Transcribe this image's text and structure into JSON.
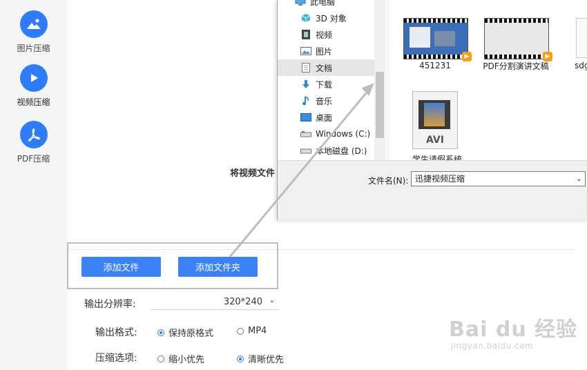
{
  "sidebar": {
    "items": [
      {
        "label": "图片压缩",
        "icon": "image-icon"
      },
      {
        "label": "视频压缩",
        "icon": "play-icon"
      },
      {
        "label": "PDF压缩",
        "icon": "pdf-icon"
      }
    ],
    "accent": "#2f7cf6"
  },
  "main": {
    "drop_text": "将视频文件",
    "add_file_button": "添加文件",
    "add_folder_button": "添加文件夹",
    "resolution_label": "输出分辨率:",
    "resolution_value": "320*240",
    "format_label": "输出格式:",
    "format_options": [
      "保持原格式",
      "MP4"
    ],
    "format_selected": "保持原格式",
    "compress_label": "压缩选项:",
    "compress_options": [
      "缩小优先",
      "清晰优先"
    ],
    "compress_selected": "清晰优先"
  },
  "dialog": {
    "tree": [
      {
        "label": "此电脑",
        "icon": "computer-icon"
      },
      {
        "label": "3D 对象",
        "icon": "cube-icon"
      },
      {
        "label": "视频",
        "icon": "video-icon"
      },
      {
        "label": "图片",
        "icon": "picture-icon"
      },
      {
        "label": "文档",
        "icon": "document-icon",
        "selected": true
      },
      {
        "label": "下载",
        "icon": "download-icon"
      },
      {
        "label": "音乐",
        "icon": "music-icon"
      },
      {
        "label": "桌面",
        "icon": "desktop-icon"
      },
      {
        "label": "Windows (C:)",
        "icon": "drive-icon"
      },
      {
        "label": "本地磁盘 (D:)",
        "icon": "drive-icon"
      }
    ],
    "files": [
      {
        "name": "451231"
      },
      {
        "name": "PDF分割演讲文稿"
      },
      {
        "name": "sdg"
      },
      {
        "name": "学生请假系统",
        "badge": "AVI"
      }
    ],
    "filename_label": "文件名(N):",
    "filename_value": "迅捷视频压缩"
  },
  "watermark": {
    "brand": "Bai du 经验",
    "url": "jingyan.baidu.com"
  }
}
